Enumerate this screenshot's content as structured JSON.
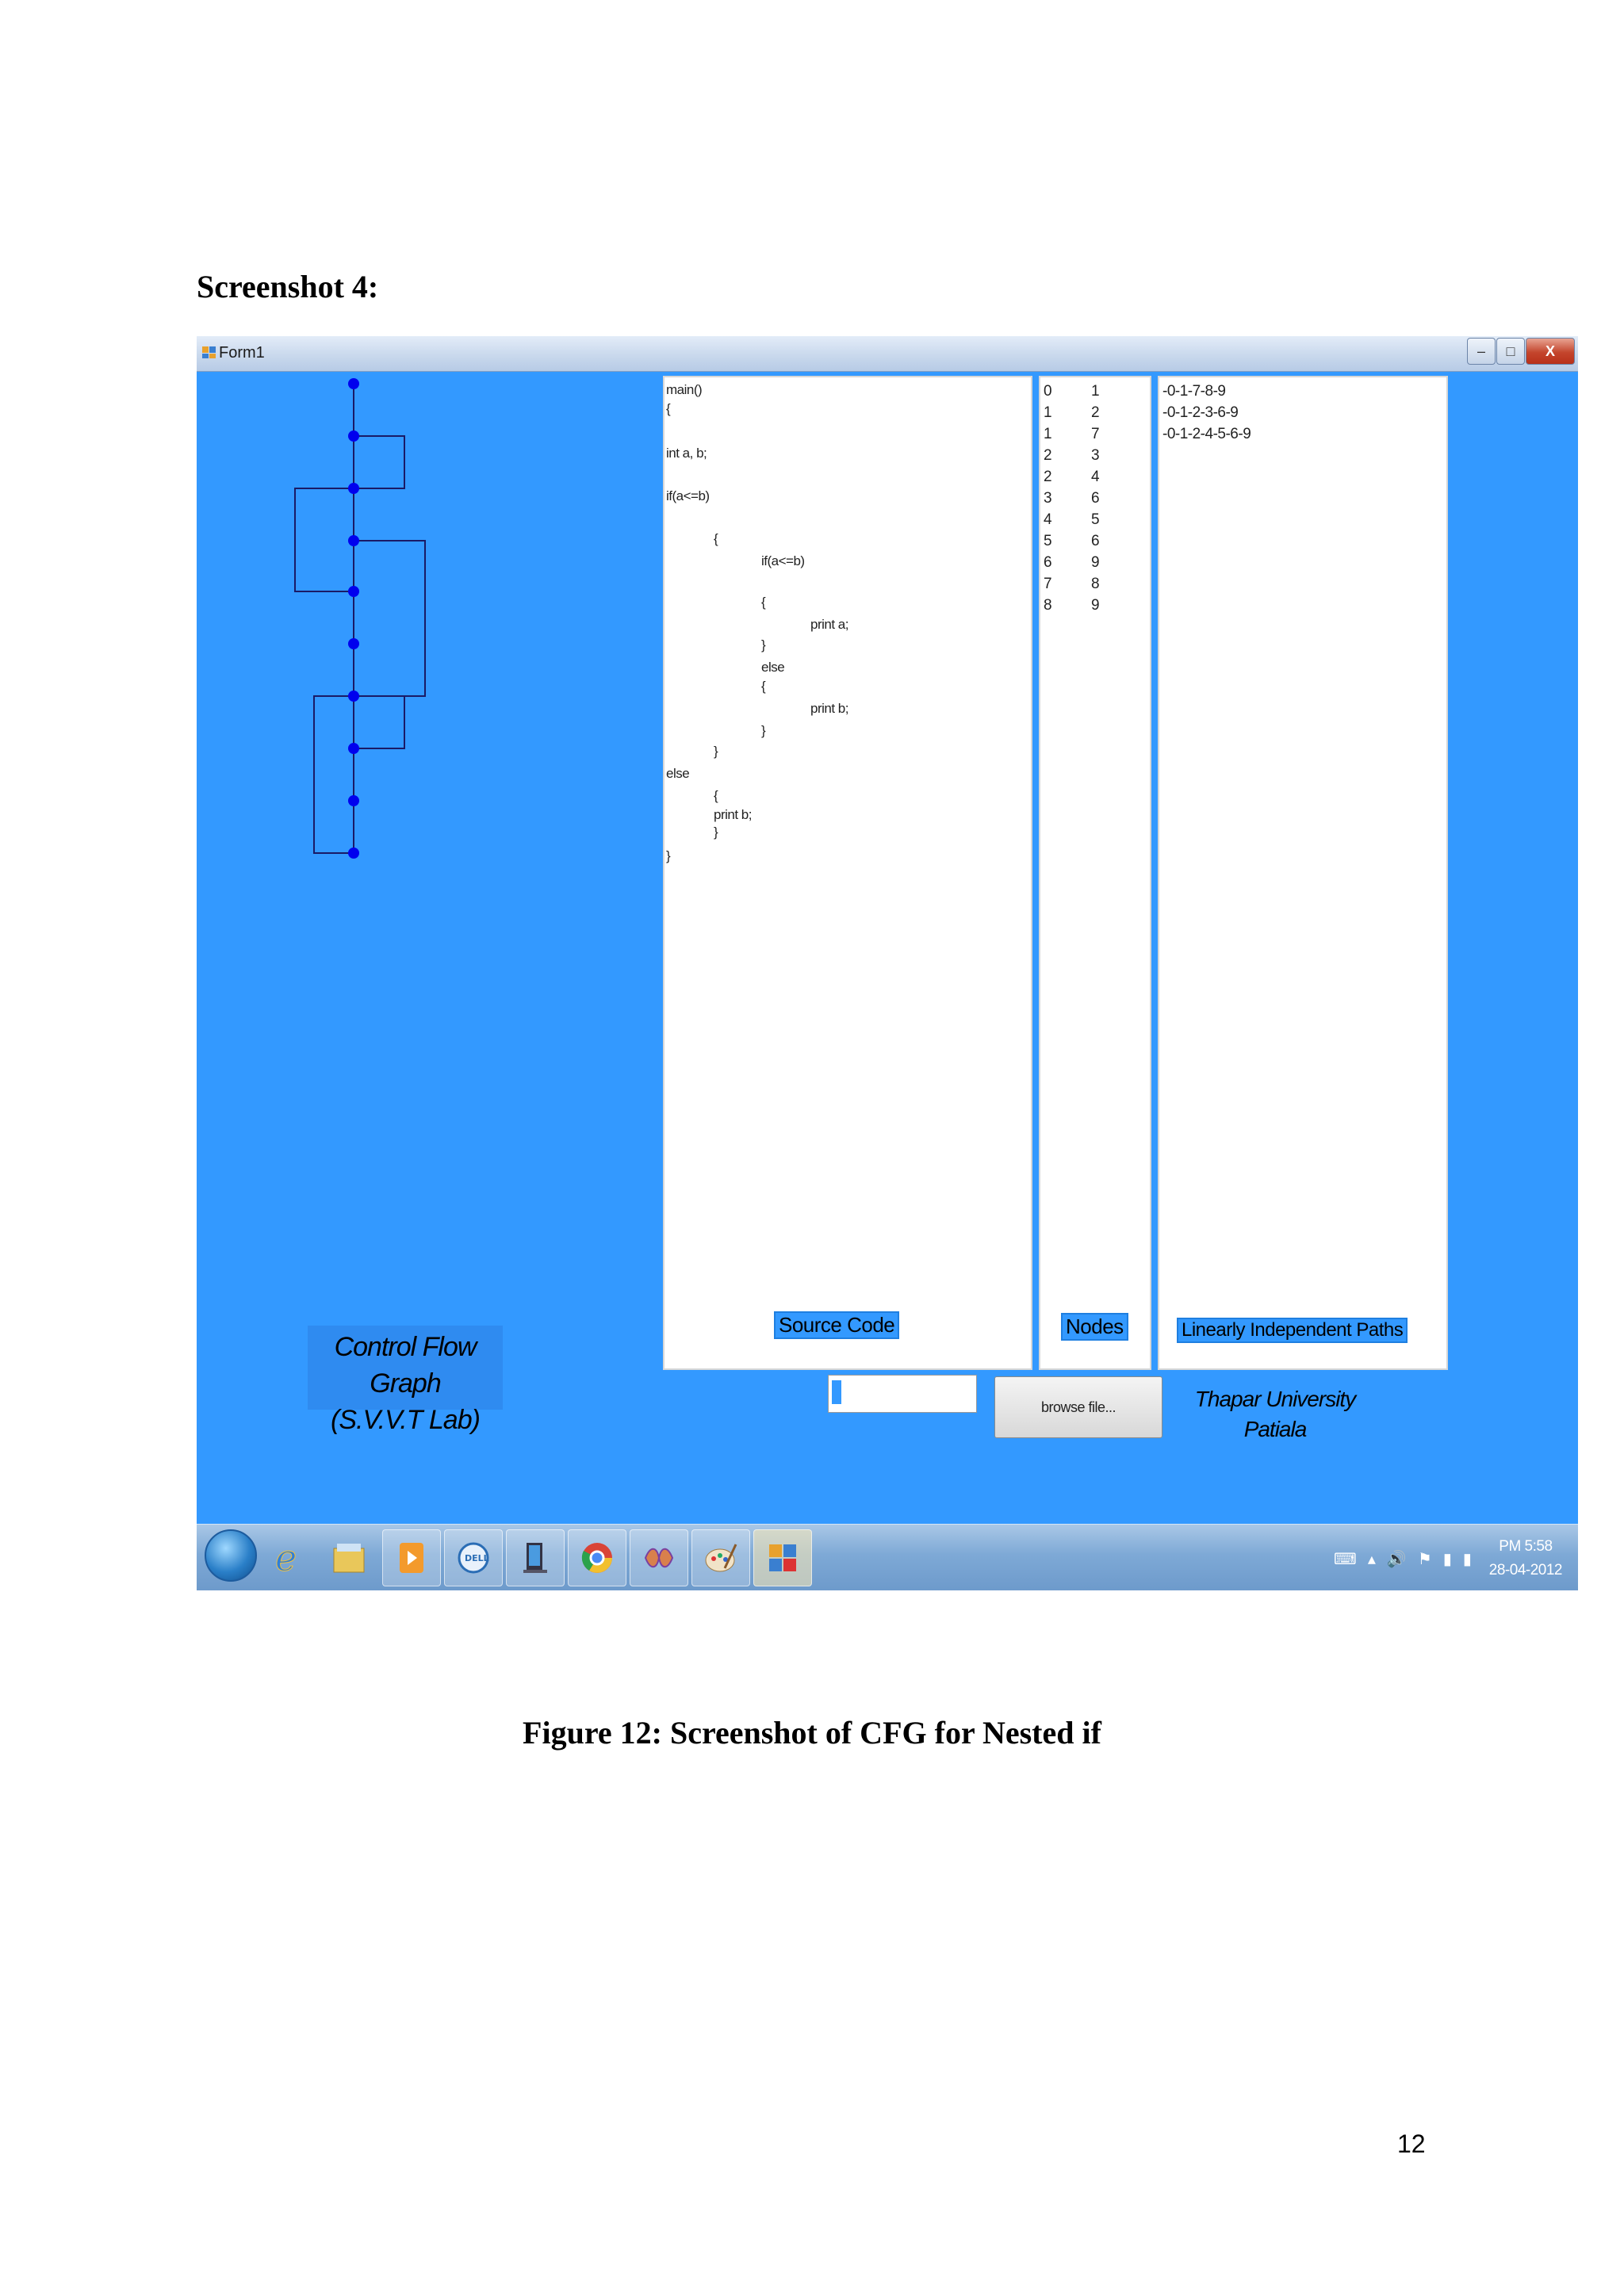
{
  "document": {
    "heading": "Screenshot 4:",
    "caption": "Figure 12: Screenshot of CFG for Nested if",
    "page_number": "12"
  },
  "window": {
    "title": "Form1",
    "buttons": {
      "minimize": "–",
      "maximize": "□",
      "close": "X"
    }
  },
  "source_code": {
    "label": "Source Code",
    "lines": [
      "main()",
      "{",
      "int a, b;",
      "if(a<=b)",
      "{",
      "if(a<=b)",
      "{",
      "print a;",
      "}",
      "else",
      "{",
      "print b;",
      "}",
      "}",
      "else",
      "{",
      "print b;",
      "}",
      "}"
    ]
  },
  "nodes": {
    "label": "Nodes",
    "rows": [
      [
        "0",
        "1"
      ],
      [
        "1",
        "2"
      ],
      [
        "1",
        "7"
      ],
      [
        "2",
        "3"
      ],
      [
        "2",
        "4"
      ],
      [
        "3",
        "6"
      ],
      [
        "4",
        "5"
      ],
      [
        "5",
        "6"
      ],
      [
        "6",
        "9"
      ],
      [
        "7",
        "8"
      ],
      [
        "8",
        "9"
      ]
    ]
  },
  "paths": {
    "label": "Linearly Independent Paths",
    "rows": [
      "-0-1-7-8-9",
      "-0-1-2-3-6-9",
      "-0-1-2-4-5-6-9"
    ]
  },
  "graph": {
    "title_line1": "Control Flow Graph",
    "title_line2": "(S.V.V.T Lab)",
    "node_color": "#0000ee"
  },
  "file_input": {
    "value": ""
  },
  "browse_button": {
    "label": "browse file..."
  },
  "university": {
    "line1": "Thapar University",
    "line2": "Patiala"
  },
  "taskbar": {
    "time": "PM 5:58",
    "date": "28-04-2012"
  },
  "colors": {
    "form_background": "#3399ff",
    "panel": "#ffffff"
  }
}
